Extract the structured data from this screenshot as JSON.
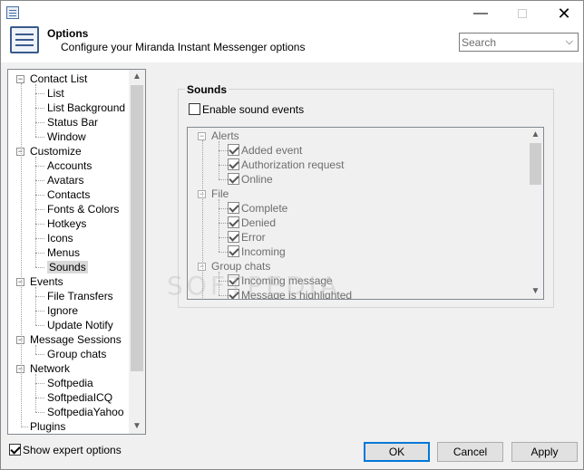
{
  "window": {
    "close_glyph": "✕",
    "min_glyph": "—"
  },
  "header": {
    "title": "Options",
    "subtitle": "Configure your Miranda Instant Messenger options",
    "search_placeholder": "Search"
  },
  "tree": {
    "items": [
      {
        "label": "Contact List",
        "level": 0,
        "expander": "−"
      },
      {
        "label": "List",
        "level": 1
      },
      {
        "label": "List Background",
        "level": 1
      },
      {
        "label": "Status Bar",
        "level": 1
      },
      {
        "label": "Window",
        "level": 1
      },
      {
        "label": "Customize",
        "level": 0,
        "expander": "−"
      },
      {
        "label": "Accounts",
        "level": 1
      },
      {
        "label": "Avatars",
        "level": 1
      },
      {
        "label": "Contacts",
        "level": 1
      },
      {
        "label": "Fonts & Colors",
        "level": 1
      },
      {
        "label": "Hotkeys",
        "level": 1
      },
      {
        "label": "Icons",
        "level": 1
      },
      {
        "label": "Menus",
        "level": 1
      },
      {
        "label": "Sounds",
        "level": 1,
        "selected": true
      },
      {
        "label": "Events",
        "level": 0,
        "expander": "−"
      },
      {
        "label": "File Transfers",
        "level": 1
      },
      {
        "label": "Ignore",
        "level": 1
      },
      {
        "label": "Update Notify",
        "level": 1
      },
      {
        "label": "Message Sessions",
        "level": 0,
        "expander": "−"
      },
      {
        "label": "Group chats",
        "level": 1
      },
      {
        "label": "Network",
        "level": 0,
        "expander": "−"
      },
      {
        "label": "Softpedia",
        "level": 1
      },
      {
        "label": "SoftpediaICQ",
        "level": 1
      },
      {
        "label": "SoftpediaYahoo",
        "level": 1
      },
      {
        "label": "Plugins",
        "level": 0
      }
    ]
  },
  "sounds": {
    "group_title": "Sounds",
    "enable_label": "Enable sound events",
    "enable_checked": false,
    "events": [
      {
        "label": "Alerts",
        "type": "group"
      },
      {
        "label": "Added event",
        "type": "item",
        "checked": true
      },
      {
        "label": "Authorization request",
        "type": "item",
        "checked": true
      },
      {
        "label": "Online",
        "type": "item",
        "checked": true
      },
      {
        "label": "File",
        "type": "group"
      },
      {
        "label": "Complete",
        "type": "item",
        "checked": true
      },
      {
        "label": "Denied",
        "type": "item",
        "checked": true
      },
      {
        "label": "Error",
        "type": "item",
        "checked": true
      },
      {
        "label": "Incoming",
        "type": "item",
        "checked": true
      },
      {
        "label": "Group chats",
        "type": "group"
      },
      {
        "label": "Incoming message",
        "type": "item",
        "checked": true
      },
      {
        "label": "Message is highlighted",
        "type": "item",
        "checked": true
      }
    ]
  },
  "footer": {
    "expert_label": "Show expert options",
    "expert_checked": true,
    "ok_label": "OK",
    "cancel_label": "Cancel",
    "apply_label": "Apply"
  }
}
